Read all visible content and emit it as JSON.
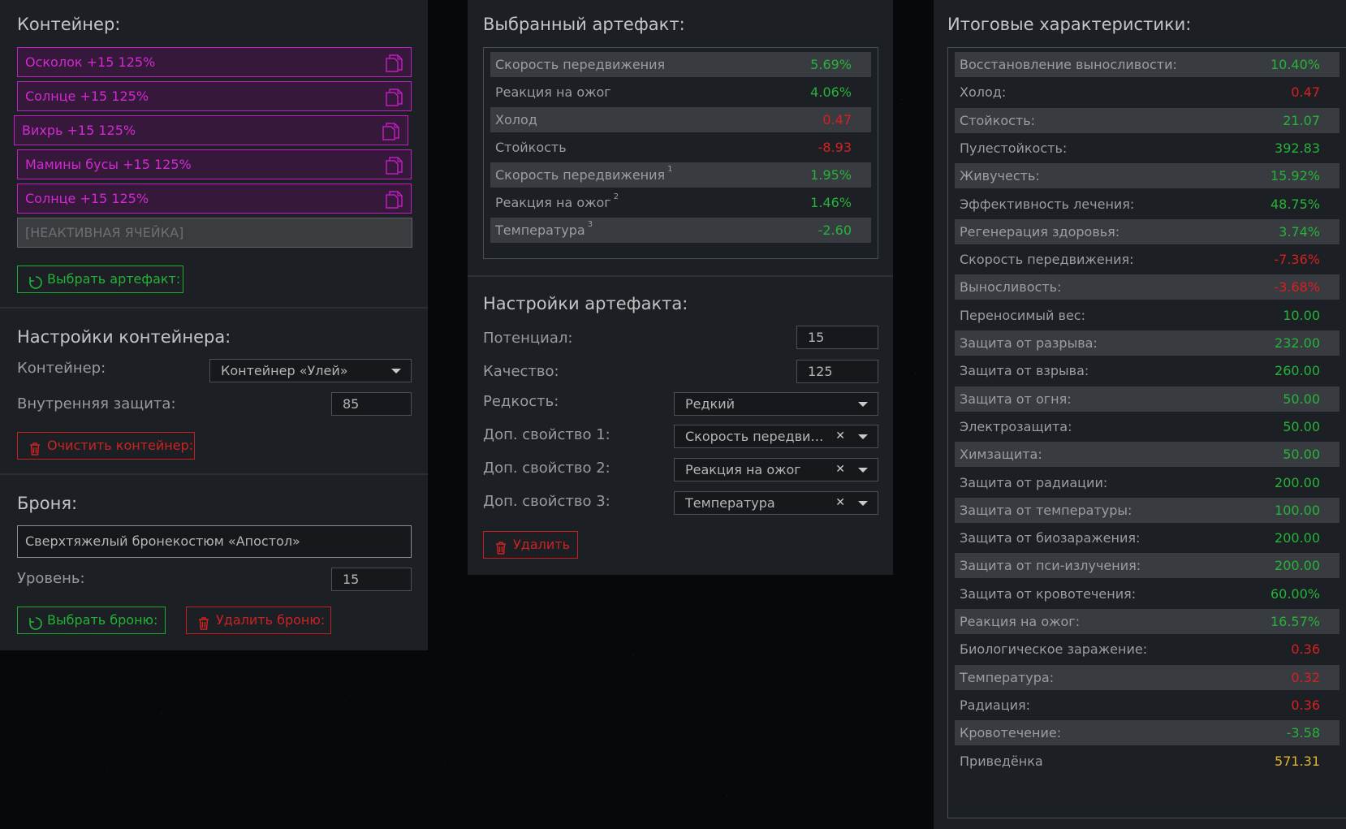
{
  "container": {
    "title": "Контейнер:",
    "slots": [
      {
        "label": "Осколок +15 125%",
        "active": true
      },
      {
        "label": "Солнце +15 125%",
        "active": true
      },
      {
        "label": "Вихрь +15 125%",
        "active": true
      },
      {
        "label": "Мамины бусы +15 125%",
        "active": true
      },
      {
        "label": "Солнце +15 125%",
        "active": true
      },
      {
        "label": "[НЕАКТИВНАЯ ЯЧЕЙКА]",
        "active": false
      }
    ],
    "select_button": "Выбрать артефакт:"
  },
  "container_settings": {
    "title": "Настройки контейнера:",
    "container_label": "Контейнер:",
    "container_value": "Контейнер «Улей»",
    "inner_protection_label": "Внутренняя защита:",
    "inner_protection_value": "85",
    "clear_button": "Очистить контейнер:"
  },
  "armor": {
    "title": "Броня:",
    "name": "Сверхтяжелый бронекостюм «Апостол»",
    "level_label": "Уровень:",
    "level_value": "15",
    "select_button": "Выбрать броню:",
    "delete_button": "Удалить броню:"
  },
  "selected_artifact": {
    "title": "Выбранный артефакт:",
    "stats": [
      {
        "label": "Скорость передвижения",
        "sup": "",
        "value": "5.69%",
        "color": "green"
      },
      {
        "label": "Реакция на ожог",
        "sup": "",
        "value": "4.06%",
        "color": "green"
      },
      {
        "label": "Холод",
        "sup": "",
        "value": "0.47",
        "color": "red"
      },
      {
        "label": "Стойкость",
        "sup": "",
        "value": "-8.93",
        "color": "red"
      },
      {
        "label": "Скорость передвижения",
        "sup": "1",
        "value": "1.95%",
        "color": "green"
      },
      {
        "label": "Реакция на ожог",
        "sup": "2",
        "value": "1.46%",
        "color": "green"
      },
      {
        "label": "Температура",
        "sup": "3",
        "value": "-2.60",
        "color": "green"
      }
    ]
  },
  "artifact_settings": {
    "title": "Настройки артефакта:",
    "potential_label": "Потенциал:",
    "potential_value": "15",
    "quality_label": "Качество:",
    "quality_value": "125",
    "rarity_label": "Редкость:",
    "rarity_value": "Редкий",
    "prop1_label": "Доп. свойство 1:",
    "prop1_value": "Скорость передвижения",
    "prop2_label": "Доп. свойство 2:",
    "prop2_value": "Реакция на ожог",
    "prop3_label": "Доп. свойство 3:",
    "prop3_value": "Температура",
    "delete_button": "Удалить"
  },
  "final_stats": {
    "title": "Итоговые характеристики:",
    "stats": [
      {
        "label": "Восстановление выносливости:",
        "value": "10.40%",
        "color": "green"
      },
      {
        "label": "Холод:",
        "value": "0.47",
        "color": "red"
      },
      {
        "label": "Стойкость:",
        "value": "21.07",
        "color": "green"
      },
      {
        "label": "Пулестойкость:",
        "value": "392.83",
        "color": "green"
      },
      {
        "label": "Живучесть:",
        "value": "15.92%",
        "color": "green"
      },
      {
        "label": "Эффективность лечения:",
        "value": "48.75%",
        "color": "green"
      },
      {
        "label": "Регенерация здоровья:",
        "value": "3.74%",
        "color": "green"
      },
      {
        "label": "Скорость передвижения:",
        "value": "-7.36%",
        "color": "red"
      },
      {
        "label": "Выносливость:",
        "value": "-3.68%",
        "color": "red"
      },
      {
        "label": "Переносимый вес:",
        "value": "10.00",
        "color": "green"
      },
      {
        "label": "Защита от разрыва:",
        "value": "232.00",
        "color": "green"
      },
      {
        "label": "Защита от взрыва:",
        "value": "260.00",
        "color": "green"
      },
      {
        "label": "Защита от огня:",
        "value": "50.00",
        "color": "green"
      },
      {
        "label": "Электрозащита:",
        "value": "50.00",
        "color": "green"
      },
      {
        "label": "Химзащита:",
        "value": "50.00",
        "color": "green"
      },
      {
        "label": "Защита от радиации:",
        "value": "200.00",
        "color": "green"
      },
      {
        "label": "Защита от температуры:",
        "value": "100.00",
        "color": "green"
      },
      {
        "label": "Защита от биозаражения:",
        "value": "200.00",
        "color": "green"
      },
      {
        "label": "Защита от пси-излучения:",
        "value": "200.00",
        "color": "green"
      },
      {
        "label": "Защита от кровотечения:",
        "value": "60.00%",
        "color": "green"
      },
      {
        "label": "Реакция на ожог:",
        "value": "16.57%",
        "color": "green"
      },
      {
        "label": "Биологическое заражение:",
        "value": "0.36",
        "color": "red"
      },
      {
        "label": "Температура:",
        "value": "0.32",
        "color": "red"
      },
      {
        "label": "Радиация:",
        "value": "0.36",
        "color": "red"
      },
      {
        "label": "Кровотечение:",
        "value": "-3.58",
        "color": "green"
      },
      {
        "label": "Приведёнка",
        "value": "571.31",
        "color": "yellow"
      }
    ]
  },
  "colors": {
    "panel_bg": "#1c1f24",
    "accent_magenta": "#c21cc2",
    "positive_green": "#27b33a",
    "negative_red": "#d82020",
    "highlight_yellow": "#e2b42a"
  },
  "icons": {
    "slot": "copy-icon",
    "select": "refresh-icon",
    "delete": "trash-icon",
    "dropdown": "chevron-down-icon",
    "clear": "clear-x-icon"
  }
}
